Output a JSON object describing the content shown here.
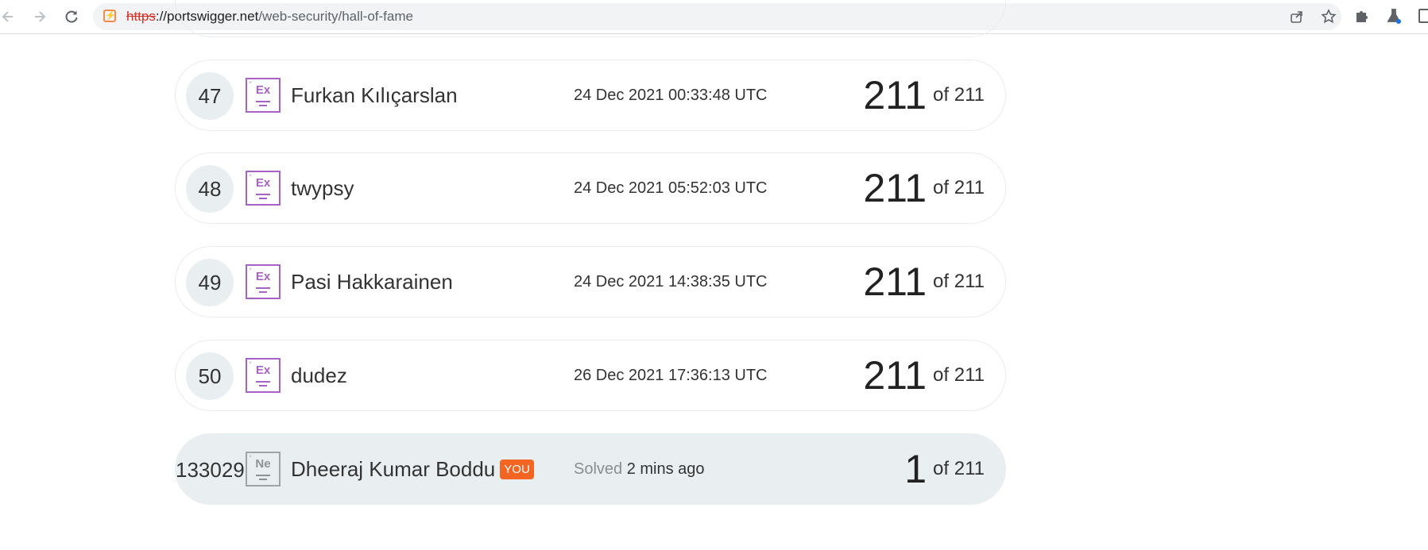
{
  "browser": {
    "url_scheme": "https",
    "url_host": "://portswigger.net",
    "url_path": "/web-security/hall-of-fame"
  },
  "icons": {
    "back": "arrow-left-icon",
    "forward": "arrow-right-icon",
    "reload": "reload-icon",
    "site": "portswigger-favicon-icon",
    "share": "share-icon",
    "star": "star-icon",
    "extensions": "puzzle-icon",
    "labs": "flask-icon"
  },
  "colors": {
    "expert_icon": "#a862c5",
    "novice_icon": "#8e9294",
    "you_badge": "#f26522",
    "row_highlight": "#e9eef0"
  },
  "leaderboard": {
    "rows": [
      {
        "rank": "47",
        "level": "Ex",
        "name": "Furkan Kılıçarslan",
        "date": "24 Dec 2021 00:33:48 UTC",
        "score": "211",
        "of": "of 211"
      },
      {
        "rank": "48",
        "level": "Ex",
        "name": "twypsy",
        "date": "24 Dec 2021 05:52:03 UTC",
        "score": "211",
        "of": "of 211"
      },
      {
        "rank": "49",
        "level": "Ex",
        "name": "Pasi Hakkarainen",
        "date": "24 Dec 2021 14:38:35 UTC",
        "score": "211",
        "of": "of 211"
      },
      {
        "rank": "50",
        "level": "Ex",
        "name": "dudez",
        "date": "26 Dec 2021 17:36:13 UTC",
        "score": "211",
        "of": "of 211"
      }
    ],
    "you": {
      "rank": "133029",
      "level": "Ne",
      "name": "Dheeraj Kumar Boddu",
      "badge": "YOU",
      "solved_label": "Solved",
      "solved_time": "2 mins ago",
      "score": "1",
      "of": "of 211"
    }
  }
}
